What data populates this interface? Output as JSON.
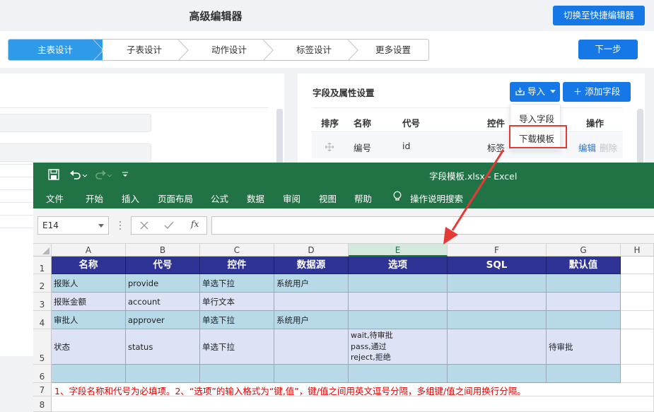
{
  "editor": {
    "title": "高级编辑器",
    "switch_button": "切换至快捷编辑器",
    "steps": [
      "主表设计",
      "子表设计",
      "动作设计",
      "标签设计",
      "更多设置"
    ],
    "next_button": "下一步",
    "right_panel": {
      "title": "字段及属性设置",
      "import_button": "导入",
      "add_button": "添加字段",
      "columns": [
        "排序",
        "名称",
        "代号",
        "控件",
        "操作"
      ],
      "row": {
        "name": "编号",
        "code": "id",
        "control": "标签",
        "edit": "编辑",
        "delete": "删除"
      }
    },
    "dropdown": [
      "导入字段",
      "下载模板"
    ]
  },
  "excel": {
    "filename": "字段模板.xlsx  -  Excel",
    "menu": [
      "文件",
      "开始",
      "插入",
      "页面布局",
      "公式",
      "数据",
      "审阅",
      "视图",
      "帮助",
      "操作说明搜索"
    ],
    "name_box": "E14",
    "fx": "fx",
    "col_letters": [
      "A",
      "B",
      "C",
      "D",
      "E",
      "F",
      "G",
      "H"
    ],
    "row_numbers": [
      "1",
      "2",
      "3",
      "4",
      "5",
      "6",
      "7",
      "8"
    ],
    "header": [
      "名称",
      "代号",
      "控件",
      "数据源",
      "选项",
      "SQL",
      "默认值"
    ],
    "rows": [
      [
        "报账人",
        "provide",
        "单选下拉",
        "系统用户",
        "",
        "",
        ""
      ],
      [
        "报账金额",
        "account",
        "单行文本",
        "",
        "",
        "",
        ""
      ],
      [
        "审批人",
        "approver",
        "单选下拉",
        "系统用户",
        "",
        "",
        ""
      ],
      [
        "状态",
        "status",
        "单选下拉",
        "",
        "wait,待审批\npass,通过\nreject,拒绝",
        "",
        "待审批"
      ],
      [
        "",
        "",
        "",
        "",
        "",
        "",
        ""
      ]
    ],
    "note": "1、字段名称和代号为必填项。2、“选项”的输入格式为“键,值”，键/值之间用英文逗号分隔，多组键/值之间用换行分隔。"
  },
  "colors": {
    "excel_green": "#217346",
    "header_blue": "#2f3396",
    "row_a": "#b7d9e8",
    "row_b": "#dde3f4",
    "primary": "#1677e6",
    "highlight_red": "#e53935"
  }
}
